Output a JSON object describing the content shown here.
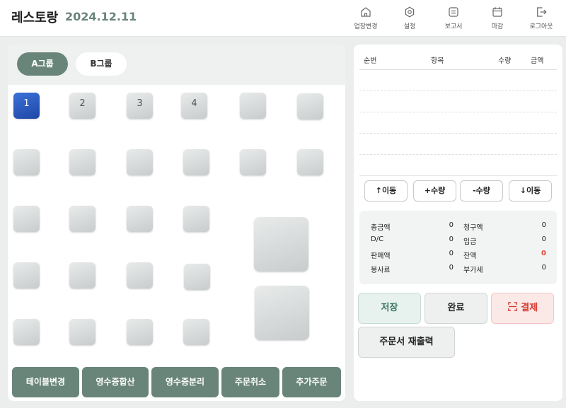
{
  "header": {
    "brand": "레스토랑",
    "date": "2024.12.11",
    "nav": [
      {
        "label": "업장변경",
        "icon": "home-icon"
      },
      {
        "label": "설정",
        "icon": "settings-icon"
      },
      {
        "label": "보고서",
        "icon": "report-icon"
      },
      {
        "label": "마감",
        "icon": "calendar-icon"
      },
      {
        "label": "로그아웃",
        "icon": "logout-icon"
      }
    ]
  },
  "groups": {
    "a": "A그룹",
    "b": "B그룹"
  },
  "tables": {
    "t1": "1",
    "t2": "2",
    "t3": "3",
    "t4": "4"
  },
  "bottom_actions": {
    "change_table": "테이블변경",
    "merge_receipt": "영수증합산",
    "split_receipt": "영수증분리",
    "cancel_order": "주문취소",
    "add_order": "추가주문"
  },
  "order_list": {
    "columns": {
      "seq": "순번",
      "item": "항목",
      "qty": "수량",
      "amount": "금액"
    },
    "rows": []
  },
  "move_buttons": {
    "up": "↑이동",
    "plus": "+수량",
    "minus": "-수량",
    "down": "↓이동"
  },
  "summary": {
    "total_label": "총금액",
    "total": "0",
    "dc_label": "D/C",
    "dc": "0",
    "sales_label": "판매액",
    "sales": "0",
    "service_label": "봉사료",
    "service": "0",
    "billed_label": "청구액",
    "billed": "0",
    "deposit_label": "입금",
    "deposit": "0",
    "balance_label": "잔액",
    "balance": "0",
    "vat_label": "부가세",
    "vat": "0"
  },
  "actions": {
    "save": "저장",
    "complete": "완료",
    "pay": "결제",
    "reprint": "주문서 재출력"
  },
  "colors": {
    "accent": "#698579",
    "selected_table": "#2b57c2",
    "balance_red": "#e0453a"
  }
}
